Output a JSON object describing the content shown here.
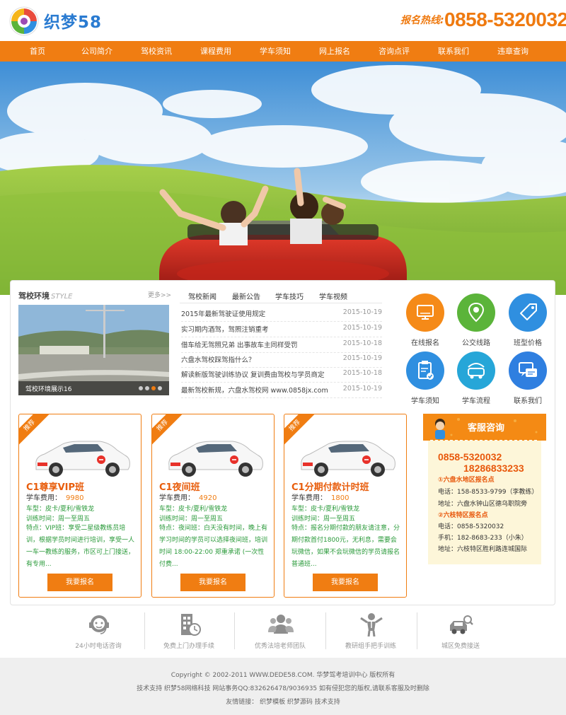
{
  "header": {
    "logo_text": "织梦58",
    "hotline_label": "报名热线:",
    "hotline_number": "0858-5320032"
  },
  "nav": [
    "首页",
    "公司简介",
    "驾校资讯",
    "课程费用",
    "学车须知",
    "网上报名",
    "咨询点评",
    "联系我们",
    "违章查询"
  ],
  "campus": {
    "title": "驾校环境",
    "title_sub": "STYLE",
    "more": "更多>>",
    "caption": "驾校环境展示16"
  },
  "news": {
    "tabs": [
      "驾校新闻",
      "最新公告",
      "学车技巧",
      "学车视频"
    ],
    "items": [
      {
        "title": "2015年最新驾驶证使用规定",
        "date": "2015-10-19"
      },
      {
        "title": "实习期内酒驾，驾照注销重考",
        "date": "2015-10-19"
      },
      {
        "title": "借车给无驾照兄弟 出事故车主同样受罚",
        "date": "2015-10-18"
      },
      {
        "title": "六盘水驾校踩驾指什么？",
        "date": "2015-10-19"
      },
      {
        "title": "解读新版驾驶训练协议 复训费由驾校与学员商定",
        "date": "2015-10-18"
      },
      {
        "title": "最新驾校新规，六盘水驾校网 www.0858jx.com",
        "date": "2015-10-19"
      }
    ]
  },
  "services": [
    {
      "label": "在线报名",
      "icon": "monitor-icon",
      "color": "#f58a18"
    },
    {
      "label": "公交线路",
      "icon": "map-pin-icon",
      "color": "#5bb43a"
    },
    {
      "label": "班型价格",
      "icon": "price-tag-icon",
      "color": "#2f8fe0"
    },
    {
      "label": "学车须知",
      "icon": "clipboard-check-icon",
      "color": "#2f8fe0"
    },
    {
      "label": "学车流程",
      "icon": "car-flow-icon",
      "color": "#26a6d8"
    },
    {
      "label": "联系我们",
      "icon": "chat-bubbles-icon",
      "color": "#2f7fe0"
    }
  ],
  "courses": [
    {
      "badge": "推荐",
      "title": "C1尊享VIP班",
      "fee_label": "学车费用：",
      "fee": "9980",
      "car_type": "车型：皮卡/夏利/雪铁龙",
      "training_time": "训练时间：周一至周五",
      "features": "特点：VIP班：享受二星级教练员培训，根据学员时间进行培训，享受一人一车一教练的服务，市区可上门接送，有专用...",
      "button": "我要报名"
    },
    {
      "badge": "推荐",
      "title": "C1夜间班",
      "fee_label": "学车费用：",
      "fee": "4920",
      "car_type": "车型：皮卡/夏利/雪铁龙",
      "training_time": "训练时间：周一至周五",
      "features": "特点：夜间班：白天没有时间，晚上有学习时间的学员可以选择夜间班，培训时间 18:00-22:00 郑重承诺 (一次性付费...",
      "button": "我要报名"
    },
    {
      "badge": "推荐",
      "title": "C1分期付款计时班",
      "fee_label": "学车费用：",
      "fee": "1800",
      "car_type": "车型：皮卡/夏利/雪铁龙",
      "training_time": "训练时间：周一至周五",
      "features": "特点：报名分期付款的朋友请注意，分期付款首付1800元，无利息，需要会玩微信，如果不会玩微信的学员请报名普通班...",
      "button": "我要报名"
    }
  ],
  "consult": {
    "title": "客服咨询",
    "phone1": "0858-5320032",
    "phone2": "18286833233",
    "branch1_title": "①六盘水地区报名点",
    "branch1_phone": "电话：158-8533-9799（李教练）",
    "branch1_addr": "地址：六盘水钟山区德乌职院旁",
    "branch2_title": "②六枝特区报名点",
    "branch2_phone": "电话：0858-5320032",
    "branch2_mobile": "手机：182-8683-233（小朱）",
    "branch2_addr": "地址：六枝特区胜利路连城国际"
  },
  "features": [
    {
      "label": "24小时电话咨询",
      "icon": "headset-icon"
    },
    {
      "label": "免费上门办理手续",
      "icon": "building-clock-icon"
    },
    {
      "label": "优秀法培老师团队",
      "icon": "team-icon"
    },
    {
      "label": "教研组手把手训练",
      "icon": "instructor-icon"
    },
    {
      "label": "城区免费接送",
      "icon": "car-search-icon"
    }
  ],
  "footer": {
    "copyright": "Copyright © 2002-2011 WWW.DEDE58.COM. 华梦驾考培训中心 版权所有",
    "support": "技术支持 织梦58网络科技 网站事务QQ:832626478/9036935 如有侵犯您的版权,请联系客服及时删除",
    "links": "友情链接：  织梦模板  织梦源码  技术支持"
  },
  "colors": {
    "accent": "#f07d12",
    "brand_blue": "#2a7bd1",
    "green_text": "#2a9a3a"
  }
}
